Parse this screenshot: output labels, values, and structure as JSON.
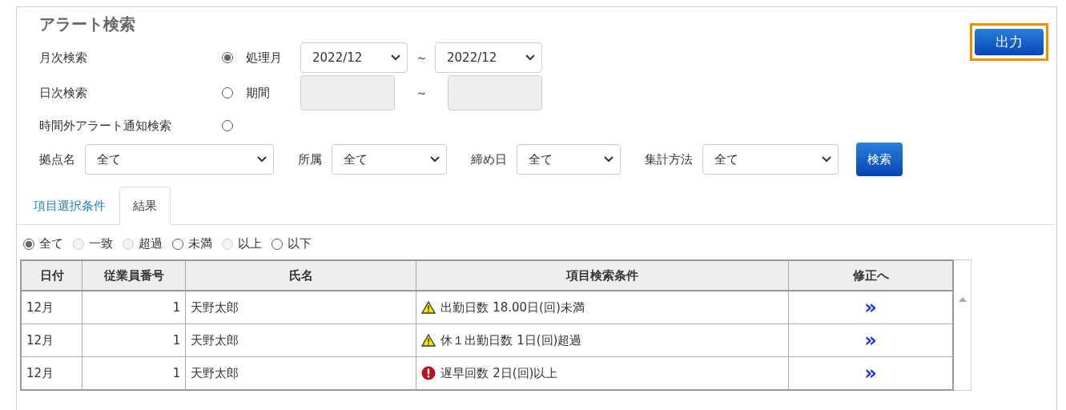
{
  "title": "アラート検索",
  "export_button": "出力",
  "modes": [
    {
      "label": "月次検索",
      "selected": true,
      "field_label": "処理月",
      "kind": "select",
      "from": "2022/12",
      "tilde": "～",
      "to": "2022/12"
    },
    {
      "label": "日次検索",
      "selected": false,
      "field_label": "期間",
      "kind": "date",
      "tilde": "～"
    },
    {
      "label": "時間外アラート通知検索",
      "selected": false,
      "kind": "none"
    }
  ],
  "filters": [
    {
      "label": "拠点名",
      "value": "全て"
    },
    {
      "label": "所属",
      "value": "全て"
    },
    {
      "label": "締め日",
      "value": "全て"
    },
    {
      "label": "集計方法",
      "value": "全て"
    }
  ],
  "search_button": "検索",
  "tabs": [
    {
      "label": "項目選択条件",
      "selected": false
    },
    {
      "label": "結果",
      "selected": true
    }
  ],
  "result_filters": [
    {
      "label": "全て",
      "selected": true,
      "disabled": false
    },
    {
      "label": "一致",
      "selected": false,
      "disabled": true
    },
    {
      "label": "超過",
      "selected": false,
      "disabled": true
    },
    {
      "label": "未満",
      "selected": false,
      "disabled": false
    },
    {
      "label": "以上",
      "selected": false,
      "disabled": true
    },
    {
      "label": "以下",
      "selected": false,
      "disabled": false
    }
  ],
  "table": {
    "columns": [
      "日付",
      "従業員番号",
      "氏名",
      "項目検索条件",
      "修正へ"
    ],
    "rows": [
      {
        "date": "12月",
        "employee_no": "1",
        "name": "天野太郎",
        "kind": "warning",
        "condition": "出勤日数 18.00日(回)未満",
        "link": "»"
      },
      {
        "date": "12月",
        "employee_no": "1",
        "name": "天野太郎",
        "kind": "warning",
        "condition": "休１出勤日数 1日(回)超過",
        "link": "»"
      },
      {
        "date": "12月",
        "employee_no": "1",
        "name": "天野太郎",
        "kind": "error",
        "condition": "遅早回数 2日(回)以上",
        "link": "»"
      }
    ]
  }
}
